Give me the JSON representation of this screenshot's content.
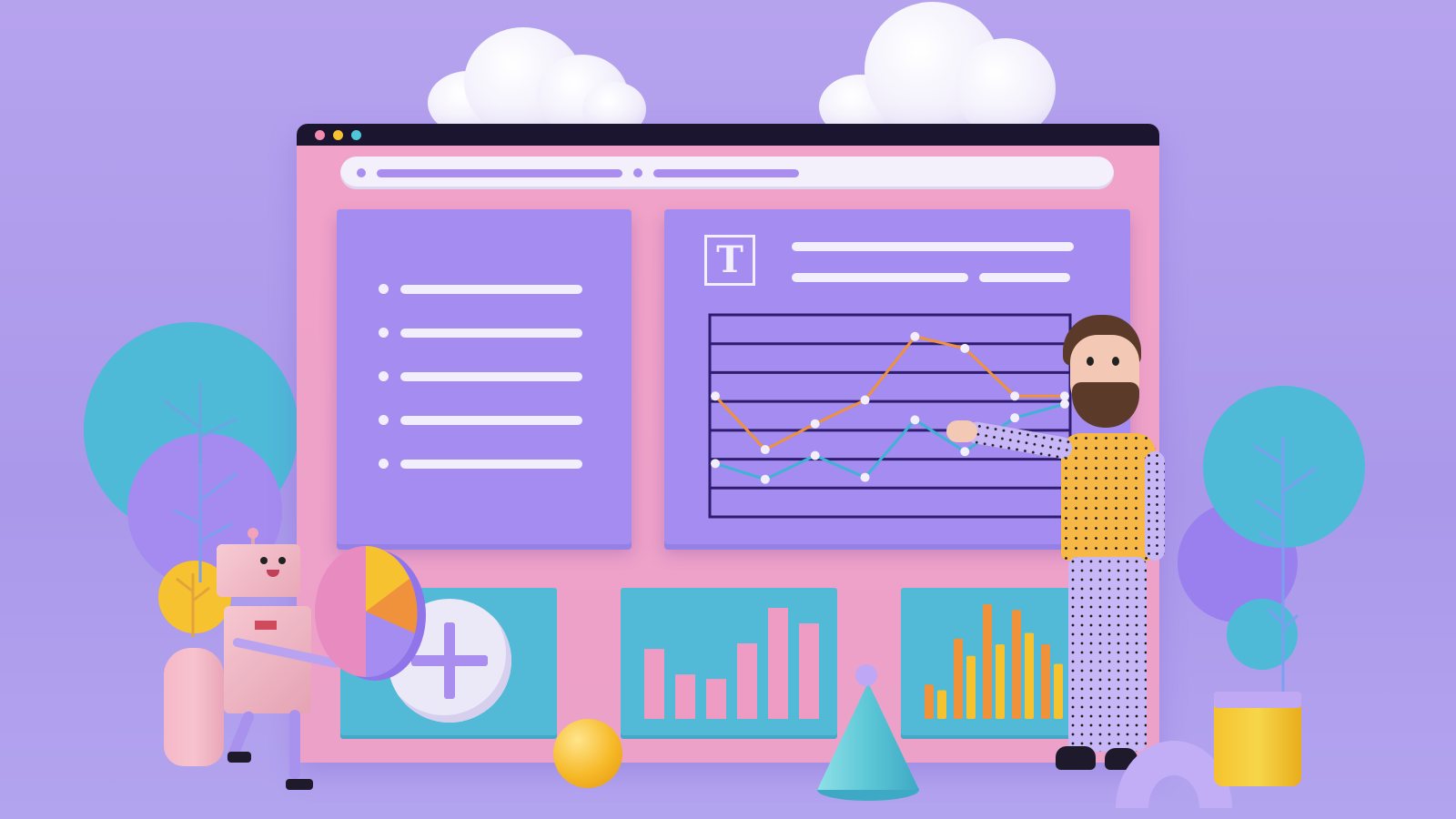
{
  "scene": {
    "description_colors": {
      "background": "#ae9cec",
      "window_frame": "#efa3c9",
      "panel": "#a48cf0",
      "card": "#52b9d6",
      "accent_orange": "#f0913b",
      "accent_yellow": "#f6c22f"
    }
  },
  "window": {
    "dots": [
      "#f28bb0",
      "#f6c22f",
      "#4fc7d9"
    ],
    "title_icon": "T"
  },
  "list_panel": {
    "items": 5
  },
  "chart_data": {
    "type": "line",
    "x": [
      0,
      1,
      2,
      3,
      4,
      5,
      6,
      7
    ],
    "series": [
      {
        "color": "#f0913b",
        "values": [
          6.0,
          3.3,
          4.6,
          5.8,
          9.0,
          8.4,
          6.0,
          6.0
        ]
      },
      {
        "color": "#3fb3d6",
        "values": [
          2.6,
          1.8,
          3.0,
          1.9,
          4.8,
          3.2,
          4.9,
          5.6
        ]
      }
    ],
    "ylim": [
      0,
      10
    ],
    "grid": true
  },
  "bar_card_1": {
    "values": [
      6.3,
      4.0,
      3.6,
      6.8,
      10.0,
      8.6
    ],
    "color": "#ee9cc3"
  },
  "bar_card_2": {
    "series": [
      {
        "color": "#f0913b",
        "values": [
          3,
          7,
          10,
          9.5,
          6.5,
          5.5
        ]
      },
      {
        "color": "#f6c22f",
        "values": [
          2.5,
          5.5,
          6.5,
          7.5,
          4.8,
          3.5
        ]
      }
    ]
  },
  "icons": {
    "traffic_lights": "window-dots-icon",
    "text": "text-t-icon",
    "add": "plus-icon",
    "pie": "pie-chart-icon"
  }
}
